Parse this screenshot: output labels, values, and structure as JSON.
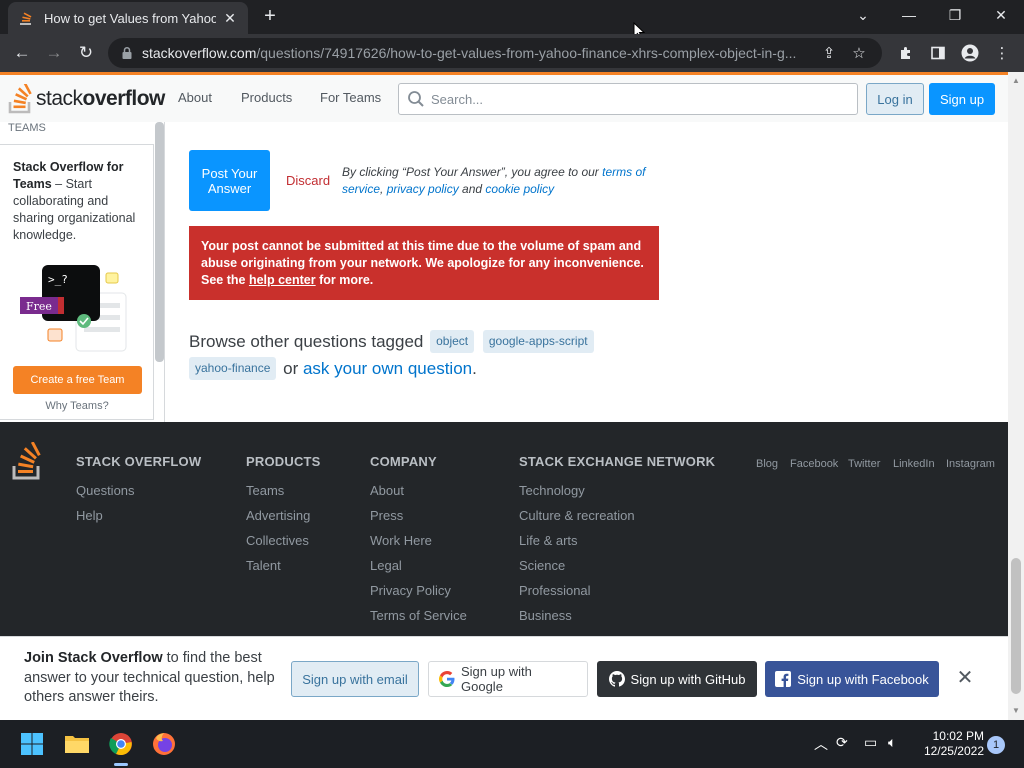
{
  "browser": {
    "tab_title": "How to get Values from Yahoo Finance",
    "url_domain": "stackoverflow.com",
    "url_path": "/questions/74917626/how-to-get-values-from-yahoo-finance-xhrs-complex-object-in-g..."
  },
  "header": {
    "logo_light": "stack",
    "logo_bold": "overflow",
    "nav": [
      "About",
      "Products",
      "For Teams"
    ],
    "search_placeholder": "Search...",
    "login": "Log in",
    "signup": "Sign up"
  },
  "sidebar": {
    "teams_heading": "TEAMS",
    "card_title": "Stack Overflow for Teams",
    "card_text": " – Start collaborating and sharing organizational knowledge.",
    "free_badge": "Free",
    "cta": "Create a free Team",
    "why": "Why Teams?"
  },
  "answer": {
    "post_button": "Post Your Answer",
    "discard": "Discard",
    "terms_prefix": "By clicking “Post Your Answer”, you agree to our ",
    "terms_link": "terms of service",
    "terms_sep": ", ",
    "privacy_link": "privacy policy",
    "terms_and": " and ",
    "cookie_link": "cookie policy"
  },
  "error": {
    "text": "Your post cannot be submitted at this time due to the volume of spam and abuse originating from your network. We apologize for any inconvenience. See the ",
    "link": "help center",
    "suffix": " for more."
  },
  "browse": {
    "prefix": "Browse other questions tagged ",
    "tags": [
      "object",
      "google-apps-script",
      "yahoo-finance"
    ],
    "or": " or ",
    "ask_link": "ask your own question",
    "period": "."
  },
  "footer": {
    "cols": [
      {
        "heading": "STACK OVERFLOW",
        "links": [
          "Questions",
          "Help"
        ]
      },
      {
        "heading": "PRODUCTS",
        "links": [
          "Teams",
          "Advertising",
          "Collectives",
          "Talent"
        ]
      },
      {
        "heading": "COMPANY",
        "links": [
          "About",
          "Press",
          "Work Here",
          "Legal",
          "Privacy Policy",
          "Terms of Service"
        ]
      },
      {
        "heading": "STACK EXCHANGE NETWORK",
        "links": [
          "Technology",
          "Culture & recreation",
          "Life & arts",
          "Science",
          "Professional",
          "Business"
        ]
      }
    ],
    "social": [
      "Blog",
      "Facebook",
      "Twitter",
      "LinkedIn",
      "Instagram"
    ]
  },
  "banner": {
    "bold": "Join Stack Overflow",
    "text": " to find the best answer to your technical question, help others answer theirs.",
    "email": "Sign up with email",
    "google": "Sign up with Google",
    "github": "Sign up with GitHub",
    "facebook": "Sign up with Facebook"
  },
  "taskbar": {
    "time": "10:02 PM",
    "date": "12/25/2022",
    "notifications": "1"
  },
  "colors": {
    "so_orange": "#f48225",
    "so_blue": "#0a95ff",
    "error_red": "#c9302c",
    "footer_bg": "#232629"
  }
}
